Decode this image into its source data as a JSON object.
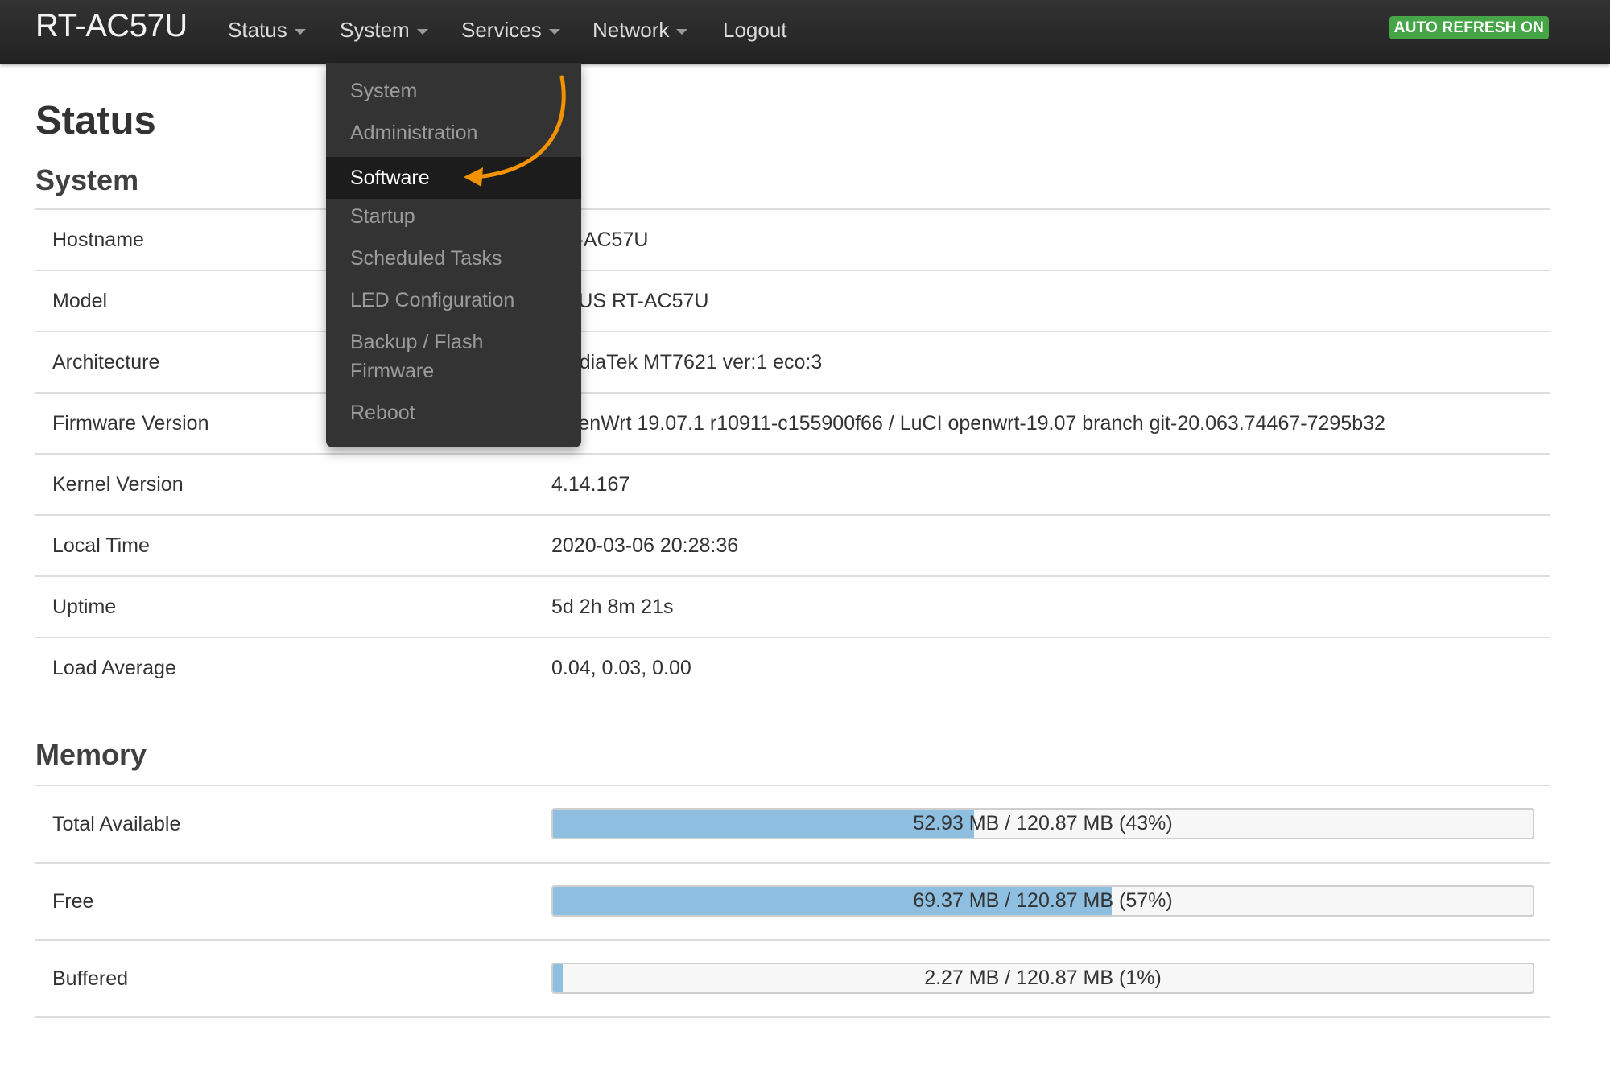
{
  "navbar": {
    "brand": "RT-AC57U",
    "menus": [
      "Status",
      "System",
      "Services",
      "Network"
    ],
    "logout": "Logout",
    "auto_refresh": "AUTO REFRESH ON",
    "auto_refresh_color": "#46a546"
  },
  "page": {
    "title": "Status",
    "system_heading": "System",
    "memory_heading": "Memory"
  },
  "system_table": [
    {
      "label": "Hostname",
      "value": "RT-AC57U"
    },
    {
      "label": "Model",
      "value": "ASUS RT-AC57U"
    },
    {
      "label": "Architecture",
      "value": "MediaTek MT7621 ver:1 eco:3"
    },
    {
      "label": "Firmware Version",
      "value": "OpenWrt 19.07.1 r10911-c155900f66 / LuCI openwrt-19.07 branch git-20.063.74467-7295b32"
    },
    {
      "label": "Kernel Version",
      "value": "4.14.167"
    },
    {
      "label": "Local Time",
      "value": "2020-03-06 20:28:36"
    },
    {
      "label": "Uptime",
      "value": "5d 2h 8m 21s"
    },
    {
      "label": "Load Average",
      "value": "0.04, 0.03, 0.00"
    }
  ],
  "memory": [
    {
      "label": "Total Available",
      "text": "52.93 MB / 120.87 MB (43%)",
      "fraction": 0.43
    },
    {
      "label": "Free",
      "text": "69.37 MB / 120.87 MB (57%)",
      "fraction": 0.57
    },
    {
      "label": "Buffered",
      "text": "2.27 MB / 120.87 MB (1%)",
      "fraction": 0.01
    }
  ],
  "system_menu": {
    "items": [
      "System",
      "Administration",
      "Software",
      "Startup",
      "Scheduled Tasks",
      "LED Configuration",
      "Backup / Flash Firmware",
      "Reboot"
    ],
    "active": "Software",
    "highlight_arrow_color": "#f39200"
  }
}
